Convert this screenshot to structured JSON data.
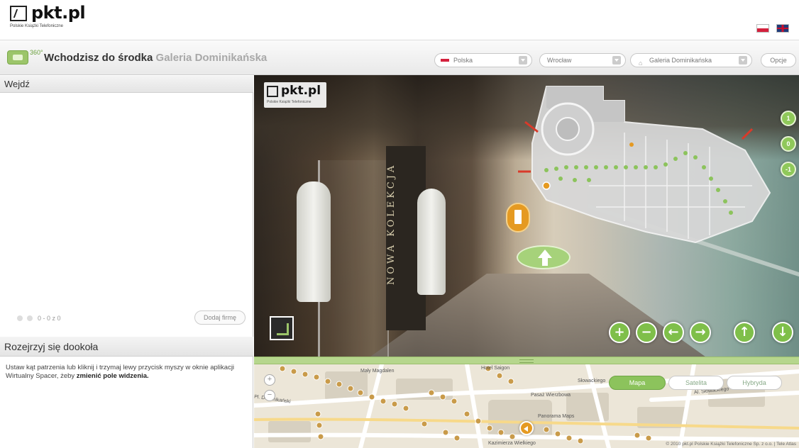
{
  "brand": {
    "logo_text": "pkt.pl",
    "tagline": "Polskie Książki Telefoniczne"
  },
  "header": {
    "badge_360": "360°",
    "title_prefix": "Wchodzisz do środka",
    "title_place": "Galeria Dominikańska",
    "country_select": "Polska",
    "city_select": "Wrocław",
    "place_select": "Galeria Dominikańska",
    "open_button": "Opcje"
  },
  "left_panel": {
    "enter_heading": "Wejdź",
    "nav_text": "0 - 0 z 0",
    "add_company_button": "Dodaj firmę",
    "look_heading": "Rozejrzyj się dookoła",
    "look_desc_part1": "Ustaw kąt patrzenia lub kliknij i trzymaj lewy przycisk myszy w oknie aplikacji Wirtualny Spacer, żeby",
    "look_desc_bold": "zmienić pole widzenia."
  },
  "panorama": {
    "store_sign": "NOWA KOLEKCJA",
    "levels": [
      "1",
      "0",
      "-1"
    ],
    "controls": {
      "zoom_in": "+",
      "zoom_out": "−",
      "rotate_left": "←",
      "rotate_right": "→",
      "forward": "↑",
      "back": "↓"
    }
  },
  "map": {
    "type_map": "Mapa",
    "type_satellite": "Satelita",
    "type_hybrid": "Hybryda",
    "zoom_in": "+",
    "zoom_out": "−",
    "streets": [
      "Pl. Dominikański",
      "Słowackiego",
      "Al. Słowackiego",
      "Kazimierza Wielkiego",
      "Hotel Saigon",
      "Mały Magdalen",
      "Pasaż Wierzbowa",
      "Panorama Maps"
    ],
    "copyright": "© 2010 pkt.pl Polskie Książki Telefoniczne Sp. z o.o. | Tele Atlas"
  },
  "colors": {
    "accent_green": "#8cc35c",
    "hotspot_orange": "#e59a22",
    "flag_red": "#d4213d"
  }
}
